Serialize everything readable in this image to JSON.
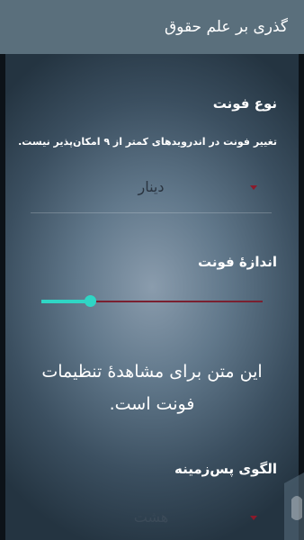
{
  "app": {
    "title": "گذری بر علم حقوق"
  },
  "settings": {
    "font_type": {
      "title": "نوع فونت",
      "note": "تغییر فونت در اندرویدهای کمتر از ۹ امکان‌پذیر نیست.",
      "selected": "دینار"
    },
    "font_size": {
      "title": "اندازهٔ فونت",
      "level": 0.22
    },
    "preview_text": "این متن برای مشاهدهٔ تنظیمات فونت است.",
    "background_pattern": {
      "title": "الگوی پس‌زمینه",
      "selected": "هشت"
    }
  },
  "colors": {
    "appbar": "#5a6f7c",
    "accent": "#2fd6c5",
    "spinner_arrow": "#8b1a2b"
  }
}
